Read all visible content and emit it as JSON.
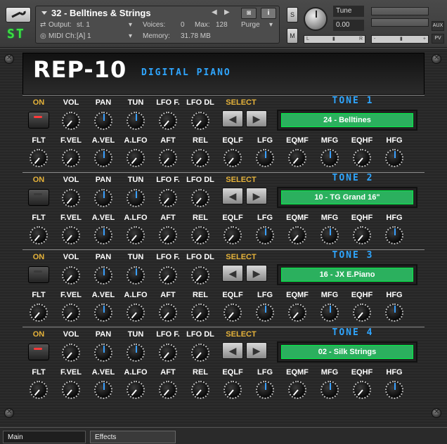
{
  "header": {
    "st_logo": "ST",
    "instrument_name": "32 - Belltines & Strings",
    "output_label": "Output:",
    "output_value": "st. 1",
    "voices_label": "Voices:",
    "voices_value": "0",
    "max_label": "Max:",
    "max_value": "128",
    "purge_label": "Purge",
    "midi_label": "MIDI Ch:",
    "midi_value": "[A] 1",
    "memory_label": "Memory:",
    "memory_value": "31.78 MB",
    "solo_label": "S",
    "mute_label": "M",
    "tune_label": "Tune",
    "tune_value": "0.00",
    "aux_label": "AUX",
    "pv_label": "PV",
    "pan_left": "L",
    "pan_right": "R",
    "vol_minus": "-",
    "vol_plus": "+"
  },
  "brand": {
    "name": "REP-10",
    "subtitle": "DIGITAL PIANO"
  },
  "labels_row1": [
    "ON",
    "VOL",
    "PAN",
    "TUN",
    "LFO F.",
    "LFO DL",
    "SELECT"
  ],
  "labels_row2": [
    "FLT",
    "F.VEL",
    "A.VEL",
    "A.LFO",
    "AFT",
    "REL",
    "EQLF",
    "LFG",
    "EQMF",
    "MFG",
    "EQHF",
    "HFG"
  ],
  "tones": [
    {
      "title": "TONE 1",
      "preset": "24 - Belltines",
      "on": true
    },
    {
      "title": "TONE 2",
      "preset": "10 - TG Grand 16\"",
      "on": false
    },
    {
      "title": "TONE 3",
      "preset": "16 - JX E.Piano",
      "on": false
    },
    {
      "title": "TONE 4",
      "preset": "02 - Silk Strings",
      "on": true
    }
  ],
  "tabs": {
    "main": "Main",
    "effects": "Effects"
  },
  "colors": {
    "label_gold": "#e6b33a",
    "tone_title_blue": "#2fa6ff",
    "display_green": "#2bb05e",
    "led_on": "#ff3a3a",
    "indicator_blue": "#3aa0ff"
  }
}
